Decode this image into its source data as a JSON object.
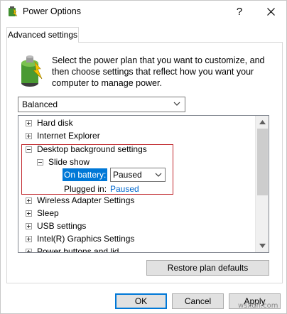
{
  "window": {
    "title": "Power Options"
  },
  "tabs": [
    {
      "label": "Advanced settings"
    }
  ],
  "description": "Select the power plan that you want to customize, and then choose settings that reflect how you want your computer to manage power.",
  "plan": {
    "selected": "Balanced"
  },
  "tree": {
    "items": [
      {
        "label": "Hard disk",
        "expander": "plus"
      },
      {
        "label": "Internet Explorer",
        "expander": "plus"
      },
      {
        "label": "Desktop background settings",
        "expander": "minus"
      },
      {
        "label": "Slide show",
        "expander": "minus"
      },
      {
        "label": "Wireless Adapter Settings",
        "expander": "plus"
      },
      {
        "label": "Sleep",
        "expander": "plus"
      },
      {
        "label": "USB settings",
        "expander": "plus"
      },
      {
        "label": "Intel(R) Graphics Settings",
        "expander": "plus"
      },
      {
        "label": "Power buttons and lid",
        "expander": "plus"
      }
    ],
    "on_battery": {
      "label": "On battery:",
      "value": "Paused"
    },
    "plugged_in": {
      "label": "Plugged in:",
      "value": "Paused"
    }
  },
  "buttons": {
    "restore": "Restore plan defaults",
    "ok": "OK",
    "cancel": "Cancel",
    "apply": "Apply"
  },
  "watermark": "wsxdn.com",
  "colors": {
    "selection": "#0078d7",
    "link": "#0066cc",
    "highlight_border": "#c0272d"
  },
  "icons": {
    "app": "power-options-icon",
    "plan": "battery-plan-icon"
  }
}
